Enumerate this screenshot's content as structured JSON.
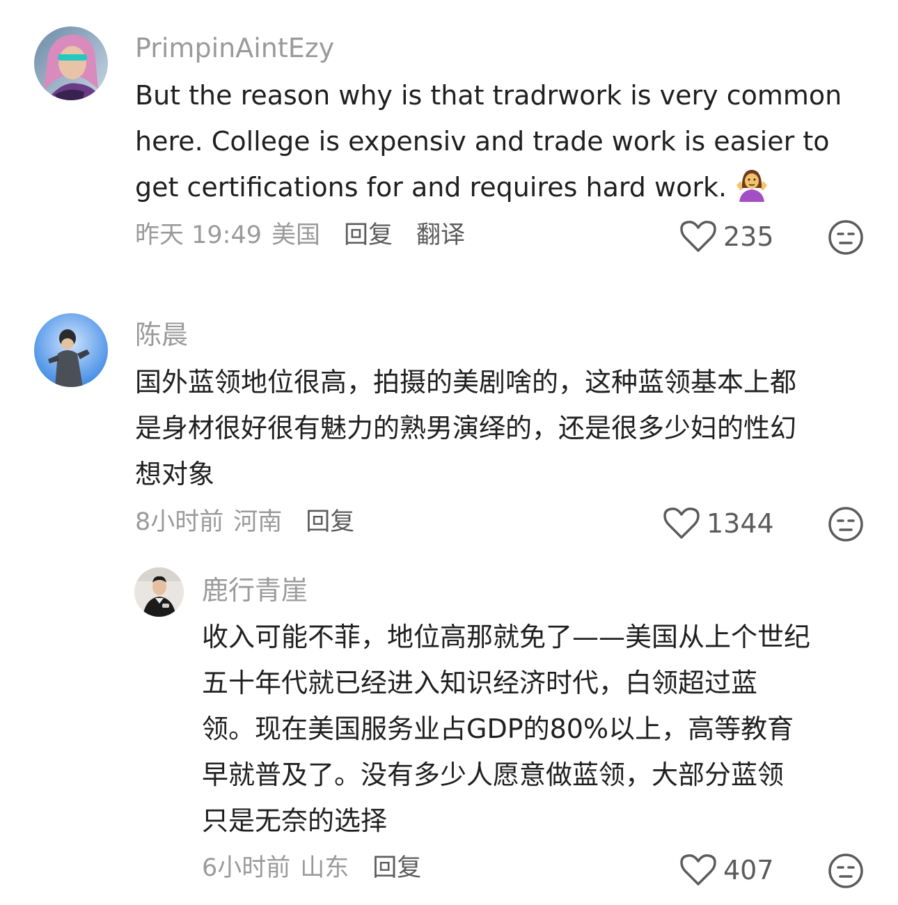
{
  "comments": [
    {
      "username": "PrimpinAintEzy",
      "lines": [
        "But the reason why is that tradrwork is very common",
        "here. College is expensiv and trade work is easier to",
        "get certifications for and requires hard work."
      ],
      "trailing_emoji": "person-shrugging-emoji",
      "time": "昨天 19:49",
      "location": "美国",
      "reply_label": "回复",
      "translate_label": "翻译",
      "likes": "235"
    },
    {
      "username": "陈晨",
      "lines": [
        "国外蓝领地位很高，拍摄的美剧啥的，这种蓝领基本上都",
        "是身材很好很有魅力的熟男演绎的，还是很多少妇的性幻",
        "想对象"
      ],
      "time": "8小时前",
      "location": "河南",
      "reply_label": "回复",
      "likes": "1344"
    },
    {
      "username": "鹿行青崖",
      "lines": [
        "收入可能不菲，地位高那就免了——美国从上个世纪",
        "五十年代就已经进入知识经济时代，白领超过蓝",
        "领。现在美国服务业占GDP的80%以上，高等教育",
        "早就普及了。没有多少人愿意做蓝领，大部分蓝领",
        "只是无奈的选择"
      ],
      "time": "6小时前",
      "location": "山东",
      "reply_label": "回复",
      "likes": "407"
    }
  ],
  "icons": {
    "like": "heart-outline-icon",
    "dislike": "neutral-face-icon"
  },
  "colors": {
    "text": "#1f1f1f",
    "muted": "#9a9a9a",
    "action": "#5b5b5b"
  }
}
